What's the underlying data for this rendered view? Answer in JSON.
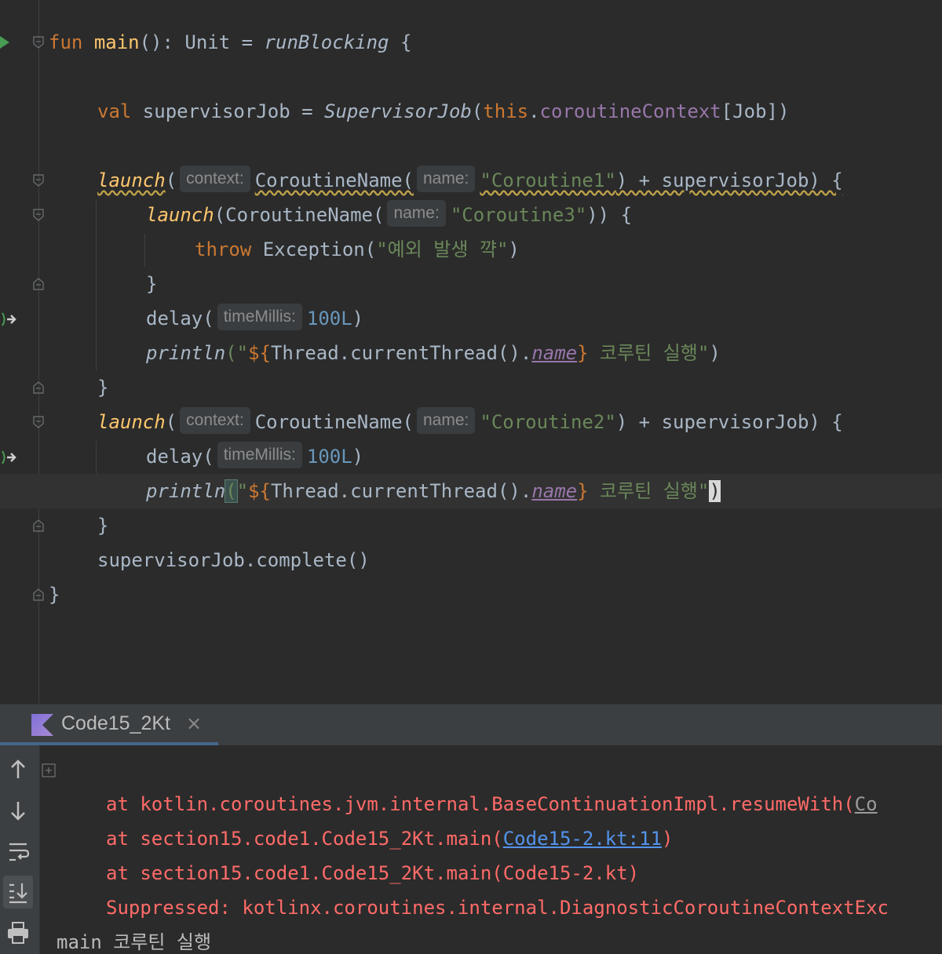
{
  "editor": {
    "lines": {
      "l1": {
        "fun": "fun",
        "main": "main",
        "rest1": "(): Unit = ",
        "runBlocking": "runBlocking",
        "rest2": " {"
      },
      "l3": {
        "val": "val",
        "rest1": " supervisorJob = ",
        "sup": "SupervisorJob",
        "p1": "(",
        "this": "this",
        "dot": ".",
        "ctx": "coroutineContext",
        "rest2": "[Job])"
      },
      "l5": {
        "launch": "launch",
        "p": "(",
        "hint_context": "context:",
        "cn": "CoroutineName(",
        "hint_name": "name:",
        "str": "\"Coroutine1\"",
        "rest": ") + supervisorJob) {"
      },
      "l6": {
        "launch": "launch",
        "cn": "(CoroutineName(",
        "hint_name": "name:",
        "str": "\"Coroutine3\"",
        "rest": ")) {"
      },
      "l7": {
        "throw": "throw",
        "ex": " Exception(",
        "str": "\"예외 발생 꺅\"",
        "rest": ")"
      },
      "l8": {
        "text": "}"
      },
      "l9": {
        "delay": "delay(",
        "hint": "timeMillis:",
        "num": "100L",
        "rest": ")"
      },
      "l10": {
        "println": "println",
        "q1": "(\"",
        "tmpl_open": "${",
        "thread": "Thread.currentThread().",
        "name": "name",
        "tmpl_close": "}",
        "str": " 코루틴 실행\"",
        "rest": ")"
      },
      "l11": {
        "text": "}"
      },
      "l12": {
        "launch": "launch",
        "p": "(",
        "hint_context": "context:",
        "cn": "CoroutineName(",
        "hint_name": "name:",
        "str": "\"Coroutine2\"",
        "rest": ") + supervisorJob) {"
      },
      "l13": {
        "delay": "delay(",
        "hint": "timeMillis:",
        "num": "100L",
        "rest": ")"
      },
      "l14": {
        "println": "println",
        "q1": "(",
        "q2": "\"",
        "tmpl_open": "${",
        "thread": "Thread.currentThread().",
        "name": "name",
        "tmpl_close": "}",
        "str": " 코루틴 실행\"",
        "rest": ")"
      },
      "l15": {
        "text": "}"
      },
      "l16": {
        "text": "supervisorJob.complete()"
      },
      "l17": {
        "text": "}"
      }
    }
  },
  "run_panel": {
    "tab_title": "Code15_2Kt",
    "close_icon": "×"
  },
  "console": {
    "line1": {
      "at": "at ",
      "text": "kotlin.coroutines.jvm.internal.BaseContinuationImpl.resumeWith(",
      "link": "Co"
    },
    "line2": {
      "at": "at ",
      "text": "section15.code1.Code15_2Kt.main(",
      "link": "Code15-2.kt:11",
      "rest": ")"
    },
    "line3": {
      "at": "at ",
      "text": "section15.code1.Code15_2Kt.main(Code15-2.kt)"
    },
    "line4": {
      "text": "Suppressed: kotlinx.coroutines.internal.DiagnosticCoroutineContextExc"
    },
    "line5": {
      "text": "main 코루틴 실행"
    }
  },
  "colors": {
    "background": "#2b2b2b",
    "keyword": "#cc7832",
    "function": "#ffc66d",
    "string": "#6a8759",
    "number": "#6897bb",
    "property": "#9876aa",
    "error": "#ff6b68",
    "link": "#5394ec"
  },
  "icons": [
    "run-gutter-icon",
    "suspend-call-icon",
    "fold-icon",
    "kotlin-icon",
    "close-icon",
    "up-arrow-icon",
    "down-arrow-icon",
    "soft-wrap-icon",
    "scroll-to-end-icon",
    "print-icon",
    "expand-icon"
  ]
}
